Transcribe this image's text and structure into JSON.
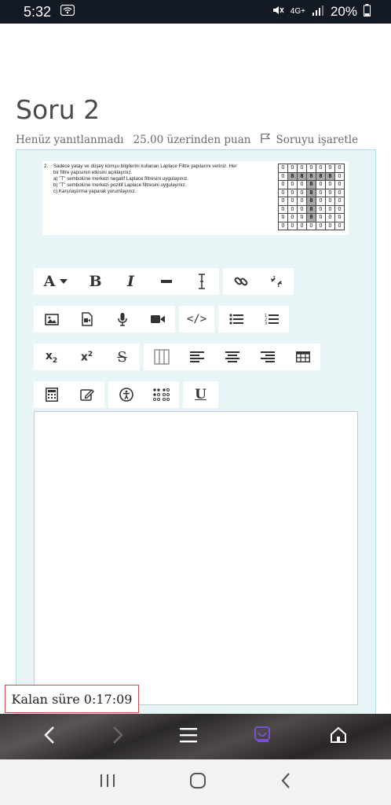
{
  "status_bar": {
    "time": "5:32",
    "network_top": "4G+",
    "battery": "20%"
  },
  "question": {
    "title": "Soru 2",
    "status": "Henüz yanıtlanmadı",
    "points": "25.00 üzerinden puan",
    "flag_label": "Soruyu işaretle",
    "image": {
      "number": "2.",
      "lines": [
        "Sadece yatay ve düşey komşu bilgilerini kullanan Laplace Filtre yapılarını veriniz. Her",
        "bir filtre yapısının etkisini açıklayınız.",
        "a) \"T\" sembolüne merkezi negatif Laplace filtresini uygulayınız.",
        "b) \"T\" sembolüne merkezi pozitif Laplace filtresini uygulayınız.",
        "c) Karşılaştırma yaparak yorumlayınız."
      ],
      "grid": [
        [
          "0",
          "0",
          "0",
          "0",
          "0",
          "0",
          "0"
        ],
        [
          "0",
          "8",
          "8",
          "8",
          "8",
          "8",
          "0"
        ],
        [
          "0",
          "0",
          "0",
          "8",
          "0",
          "0",
          "0"
        ],
        [
          "0",
          "0",
          "0",
          "8",
          "0",
          "0",
          "0"
        ],
        [
          "0",
          "0",
          "0",
          "8",
          "0",
          "0",
          "0"
        ],
        [
          "0",
          "0",
          "0",
          "8",
          "0",
          "0",
          "0"
        ],
        [
          "0",
          "0",
          "0",
          "8",
          "0",
          "0",
          "0"
        ],
        [
          "0",
          "0",
          "0",
          "0",
          "0",
          "0",
          "0"
        ]
      ]
    }
  },
  "toolbar": {
    "font_label": "A",
    "bold": "B",
    "italic": "I",
    "underline": "U",
    "subscript_base": "x",
    "subscript_idx": "2",
    "superscript_base": "x",
    "superscript_idx": "2",
    "strike": "S",
    "code": "</>"
  },
  "timer": {
    "text": "Kalan süre 0:17:09"
  },
  "colors": {
    "accent_box": "#e7f5f6",
    "timer_border": "#c0504d",
    "active_tab": "#7b4fd6"
  }
}
